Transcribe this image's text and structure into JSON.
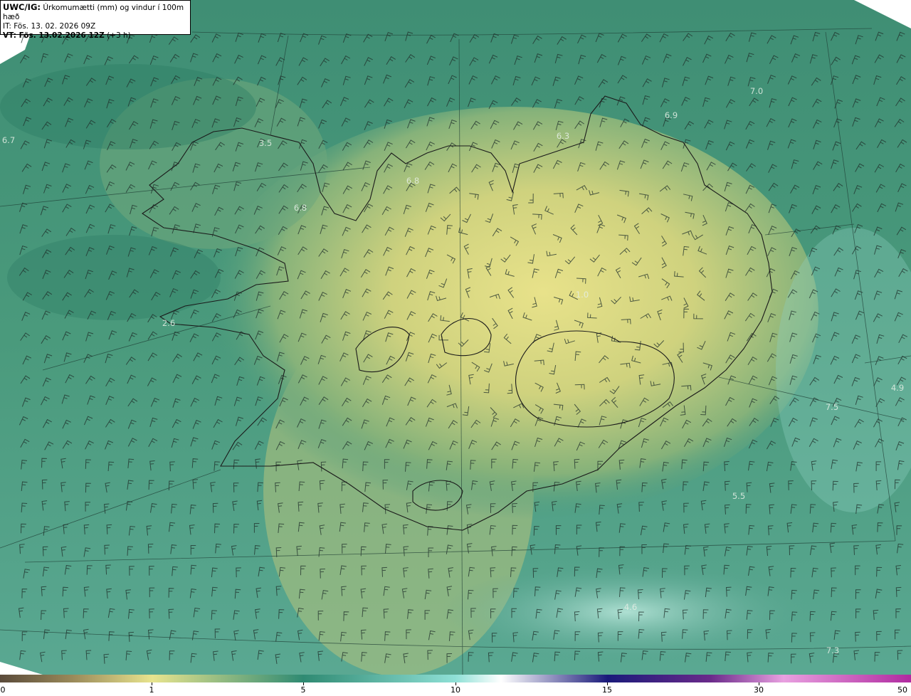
{
  "header": {
    "model_label": "UWC/IG:",
    "product": "Úrkomumætti (mm) og vindur í 100m hæð",
    "it_line": "IT: Fös. 13. 02. 2026 09Z",
    "vt_label": "VT: Fös. 13.02.2026 12Z",
    "vt_suffix": "(+3 h)"
  },
  "colorbar": {
    "ticks": [
      "0",
      "1",
      "5",
      "10",
      "15",
      "30",
      "50"
    ],
    "colors": [
      "#5a4a3a",
      "#9a8a5a",
      "#e8e48e",
      "#2f8a72",
      "#8fe0d6",
      "#ffffff",
      "#1a1a7a",
      "#6a2a8a",
      "#e8a0e0",
      "#b02aa0"
    ]
  },
  "map_values": [
    "3.5",
    "6.7",
    "6.8",
    "6.8",
    "6.3",
    "6.9",
    "7.0",
    "2.6",
    "1.0",
    "4.9",
    "7.5",
    "5.5",
    "4.6",
    "7.3"
  ]
}
